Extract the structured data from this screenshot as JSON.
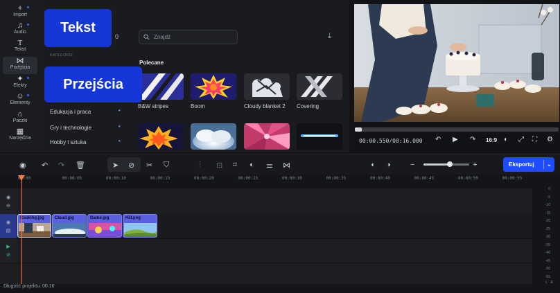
{
  "sidebar": {
    "items": [
      {
        "label": "Import",
        "icon": "plus-icon"
      },
      {
        "label": "Audio",
        "icon": "music-note-icon"
      },
      {
        "label": "Tekst",
        "icon": "text-icon"
      },
      {
        "label": "Przejścia",
        "icon": "transition-icon"
      },
      {
        "label": "Efekty",
        "icon": "sparkle-icon"
      },
      {
        "label": "Elementy",
        "icon": "smiley-icon"
      },
      {
        "label": "Paczki",
        "icon": "bag-icon"
      },
      {
        "label": "Narzędzia",
        "icon": "grid-icon"
      }
    ]
  },
  "panel": {
    "count": "0",
    "search_placeholder": "Znajdź",
    "categories_heading": "KATEGORIE",
    "categories": [
      "Edukacja i praca",
      "Gry i technologie",
      "Hobby i sztuka"
    ],
    "section_title": "Polecane",
    "tiles": [
      {
        "label": "B&W stripes"
      },
      {
        "label": "Boom"
      },
      {
        "label": "Cloudy blanket 2"
      },
      {
        "label": "Covering"
      },
      {
        "label": ""
      },
      {
        "label": ""
      },
      {
        "label": ""
      },
      {
        "label": ""
      }
    ]
  },
  "callouts": {
    "tekst": "Tekst",
    "przejscia": "Przejścia"
  },
  "preview": {
    "timecode": "00:00.550/00:16.000",
    "aspect_ratio": "16:9",
    "progress": 0.034
  },
  "toolbar": {
    "export_label": "Eksportuj",
    "zoom_level": 0.55
  },
  "timeline": {
    "ruler_labels": [
      "00:00",
      "00:00:05",
      "00:00:10",
      "00:00:15",
      "00:00:20",
      "00:00:25",
      "00:00:30",
      "00:00:35",
      "00:00:40",
      "00:00:45",
      "00:00:50",
      "00:00:55"
    ],
    "clips": [
      {
        "name": "Cooking.jpg"
      },
      {
        "name": "Cloud.jpg"
      },
      {
        "name": "Game.jpg"
      },
      {
        "name": "Hill.png"
      }
    ],
    "db_labels": [
      "0",
      "-5",
      "-10",
      "-15",
      "-20",
      "-25",
      "-30",
      "-35",
      "-40",
      "-45",
      "-50",
      "-55"
    ],
    "meter_channels": [
      "L",
      "R"
    ]
  },
  "status": {
    "project_length": "Długość projektu: 00:16"
  },
  "colors": {
    "accent": "#1f4cff",
    "callout": "#1637d8",
    "playhead": "#ff7a3c",
    "clip": "#5a5fe0"
  }
}
